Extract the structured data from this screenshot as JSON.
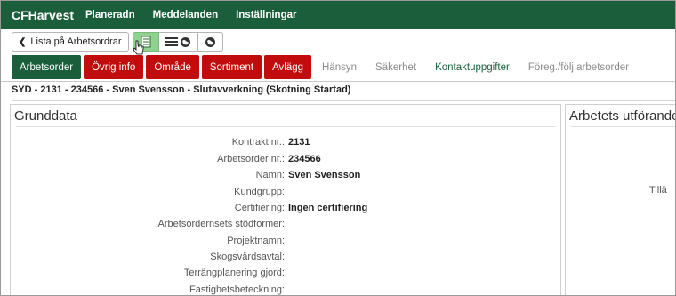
{
  "app": {
    "brand": "CFHarvest"
  },
  "nav": [
    "Planeradn",
    "Meddelanden",
    "Inställningar"
  ],
  "toolbar": {
    "back_label": "Lista på Arbetsordrar",
    "back_icon": "chevron-left-icon",
    "view_icons": [
      "document-list-icon",
      "list-globe-icon",
      "globe-icon"
    ]
  },
  "tabs": [
    {
      "label": "Arbetsorder",
      "state": "active"
    },
    {
      "label": "Övrig info",
      "state": "red"
    },
    {
      "label": "Område",
      "state": "red"
    },
    {
      "label": "Sortiment",
      "state": "red"
    },
    {
      "label": "Avlägg",
      "state": "red"
    },
    {
      "label": "Hänsyn",
      "state": "plain"
    },
    {
      "label": "Säkerhet",
      "state": "plain"
    },
    {
      "label": "Kontaktuppgifter",
      "state": "green-text"
    },
    {
      "label": "Föreg./följ.arbetsorder",
      "state": "plain"
    }
  ],
  "order_title": "SYD - 2131 - 234566 - Sven Svensson - Slutavverkning (Skotning Startad)",
  "grunddata": {
    "title": "Grunddata",
    "fields": [
      {
        "label": "Kontrakt nr.:",
        "value": "2131"
      },
      {
        "label": "Arbetsorder nr.:",
        "value": "234566"
      },
      {
        "label": "Namn:",
        "value": "Sven Svensson"
      },
      {
        "label": "Kundgrupp:",
        "value": ""
      },
      {
        "label": "Certifiering:",
        "value": "Ingen certifiering"
      },
      {
        "label": "Arbetsordernsets stödformer:",
        "value": ""
      },
      {
        "label": "Projektnamn:",
        "value": ""
      },
      {
        "label": "Skogsvårdsavtal:",
        "value": ""
      },
      {
        "label": "Terrängplanering gjord:",
        "value": ""
      },
      {
        "label": "Fastighetsbeteckning:",
        "value": ""
      }
    ]
  },
  "arbetets": {
    "title": "Arbetets utförande",
    "label_fragment": "Tillä"
  },
  "colors": {
    "primary": "#1b5e3b",
    "danger": "#c00c0c",
    "active_view": "#8fd28f"
  }
}
